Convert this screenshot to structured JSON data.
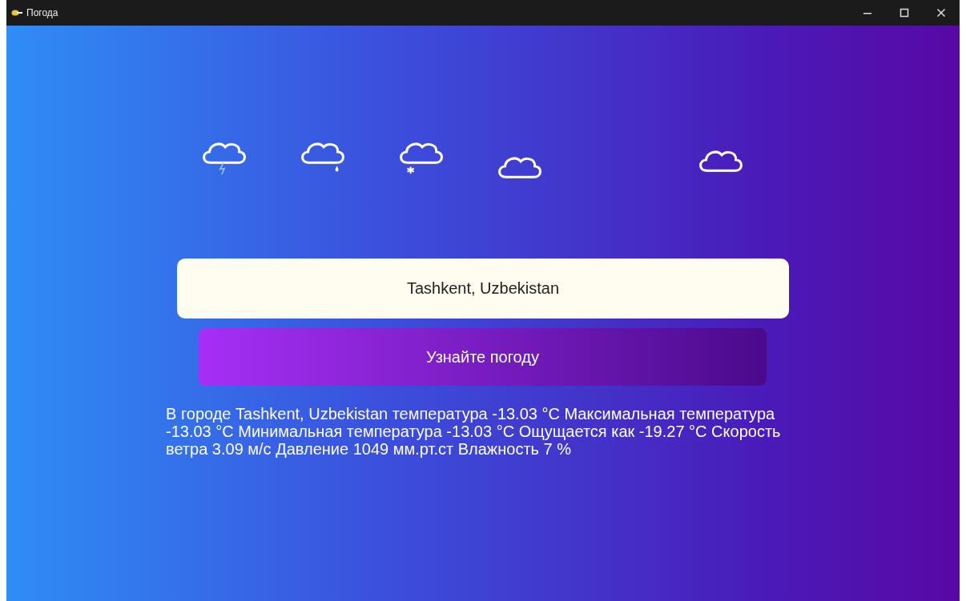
{
  "window": {
    "title": "Погода"
  },
  "weather_icons": [
    {
      "kind": "lightning"
    },
    {
      "kind": "rain"
    },
    {
      "kind": "snow"
    },
    {
      "kind": "cloud"
    },
    {
      "kind": "cloud"
    }
  ],
  "city_field": {
    "value": "Tashkent, Uzbekistan"
  },
  "submit_button": {
    "label": "Узнайте погоду"
  },
  "result": "В городе Tashkent, Uzbekistan температура -13.03 °C Максимальная температура -13.03 °C Минимальная температура -13.03 °C Ощущается как -19.27 °C Скорость ветра 3.09 м/с Давление 1049 мм.рт.ст Влажность 7 %"
}
